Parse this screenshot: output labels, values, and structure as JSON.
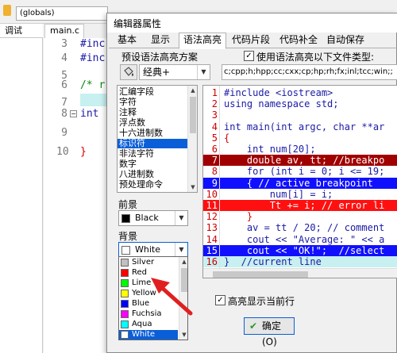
{
  "ide": {
    "globals_combo": "(globals)",
    "left_tab": "调试",
    "file_tab": "main.c",
    "lines": [
      {
        "num": "3",
        "code": "#inc",
        "color": "#1a1aa6"
      },
      {
        "num": "4",
        "code": "#inc",
        "color": "#1a1aa6"
      },
      {
        "num": "5",
        "code": "",
        "color": "#000000"
      },
      {
        "num": "6",
        "code": "/* r",
        "color": "#0a8a0a"
      },
      {
        "num": "7",
        "code": "",
        "color": "#000000"
      },
      {
        "num": "8",
        "code": "int",
        "color": "#1a1aa6"
      },
      {
        "num": "9",
        "code": "",
        "color": "#000000"
      },
      {
        "num": "10",
        "code": "}",
        "color": "#cc0000"
      }
    ]
  },
  "dialog": {
    "title": "编辑器属性",
    "tabs": [
      "基本",
      "显示",
      "语法高亮",
      "代码片段",
      "代码补全",
      "自动保存"
    ],
    "active_tab": "语法高亮",
    "preset_label": "预设语法高亮方案",
    "scheme_value": "经典+",
    "use_highlight_label": "使用语法高亮以下文件类型:",
    "use_highlight_checked": true,
    "file_types": "c;cpp;h;hpp;cc;cxx;cp;hp;rh;fx;inl;tcc;win;;",
    "elements": [
      "汇编字段",
      "字符",
      "注释",
      "浮点数",
      "十六进制数",
      "标识符",
      "非法字符",
      "数字",
      "八进制数",
      "预处理命令"
    ],
    "selected_element": "标识符",
    "foreground_label": "前景",
    "foreground_value": "Black",
    "background_label": "背景",
    "background_value": "White",
    "color_options": [
      {
        "label": "Silver",
        "color": "#c0c0c0"
      },
      {
        "label": "Red",
        "color": "#ff0000"
      },
      {
        "label": "Lime",
        "color": "#00ff00"
      },
      {
        "label": "Yellow",
        "color": "#ffff00"
      },
      {
        "label": "Blue",
        "color": "#0000ff"
      },
      {
        "label": "Fuchsia",
        "color": "#ff00ff"
      },
      {
        "label": "Aqua",
        "color": "#00ffff"
      },
      {
        "label": "White",
        "color": "#ffffff"
      }
    ],
    "selected_color": "White",
    "highlight_current_line_label": "高亮显示当前行",
    "highlight_current_line_checked": true,
    "ok_label": "确定(O)"
  },
  "preview": {
    "lines": [
      {
        "num": "1",
        "code": "#include <iostream>",
        "fg": "#1a1aa6",
        "bg": "#ffffff"
      },
      {
        "num": "2",
        "code": "using namespace std;",
        "fg": "#1a1aa6",
        "bg": "#ffffff"
      },
      {
        "num": "3",
        "code": "",
        "fg": "#000000",
        "bg": "#ffffff"
      },
      {
        "num": "4",
        "code": "int main(int argc, char **ar",
        "fg": "#1a1aa6",
        "bg": "#ffffff"
      },
      {
        "num": "5",
        "code": "{",
        "fg": "#cc0000",
        "bg": "#ffffff"
      },
      {
        "num": "6",
        "code": "    int num[20];",
        "fg": "#1a1aa6",
        "bg": "#ffffff"
      },
      {
        "num": "7",
        "code": "    double av, tt; //breakpo",
        "fg": "#ffffff",
        "bg": "#a00000"
      },
      {
        "num": "8",
        "code": "    for (int i = 0; i <= 19;",
        "fg": "#1a1aa6",
        "bg": "#ffffff"
      },
      {
        "num": "9",
        "code": "    { // active breakpoint",
        "fg": "#ffffff",
        "bg": "#1010ff"
      },
      {
        "num": "10",
        "code": "        num[i] = i;",
        "fg": "#1a1aa6",
        "bg": "#ffffff"
      },
      {
        "num": "11",
        "code": "        Tt += i; // error li",
        "fg": "#ffffff",
        "bg": "#ff1010"
      },
      {
        "num": "12",
        "code": "    }",
        "fg": "#cc0000",
        "bg": "#ffffff"
      },
      {
        "num": "13",
        "code": "    av = tt / 20; // comment",
        "fg": "#1a1aa6",
        "bg": "#ffffff"
      },
      {
        "num": "14",
        "code": "    cout << \"Average: \" << a",
        "fg": "#1a1aa6",
        "bg": "#ffffff"
      },
      {
        "num": "15",
        "code": "    cout << \"OK!\";  //select",
        "fg": "#ffffff",
        "bg": "#1010ff"
      },
      {
        "num": "16",
        "code": "}  //current line",
        "fg": "#1a1aa6",
        "bg": "#c8f0f0"
      }
    ]
  },
  "annotation_color": "#e02020"
}
